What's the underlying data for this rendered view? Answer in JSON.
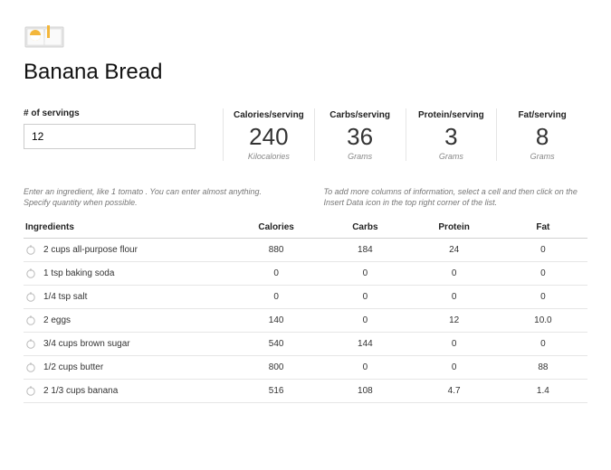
{
  "header": {
    "title": "Banana Bread",
    "icon": "recipe-book-icon"
  },
  "servings": {
    "label": "# of servings",
    "value": "12"
  },
  "stats": [
    {
      "title": "Calories/serving",
      "value": "240",
      "unit": "Kilocalories"
    },
    {
      "title": "Carbs/serving",
      "value": "36",
      "unit": "Grams"
    },
    {
      "title": "Protein/serving",
      "value": "3",
      "unit": "Grams"
    },
    {
      "title": "Fat/serving",
      "value": "8",
      "unit": "Grams"
    }
  ],
  "hints": {
    "left": "Enter an ingredient, like 1 tomato . You can enter almost anything. Specify quantity when possible.",
    "right": "To add more columns of information, select a cell and then click on the Insert Data icon in the top right corner of the list."
  },
  "table": {
    "headers": [
      "Ingredients",
      "Calories",
      "Carbs",
      "Protein",
      "Fat"
    ],
    "rows": [
      {
        "name": "2 cups all-purpose flour",
        "calories": "880",
        "carbs": "184",
        "protein": "24",
        "fat": "0"
      },
      {
        "name": "1 tsp baking soda",
        "calories": "0",
        "carbs": "0",
        "protein": "0",
        "fat": "0"
      },
      {
        "name": "1/4 tsp salt",
        "calories": "0",
        "carbs": "0",
        "protein": "0",
        "fat": "0"
      },
      {
        "name": "2 eggs",
        "calories": "140",
        "carbs": "0",
        "protein": "12",
        "fat": "10.0"
      },
      {
        "name": "3/4 cups brown sugar",
        "calories": "540",
        "carbs": "144",
        "protein": "0",
        "fat": "0"
      },
      {
        "name": "1/2 cups butter",
        "calories": "800",
        "carbs": "0",
        "protein": "0",
        "fat": "88"
      },
      {
        "name": "2 1/3 cups banana",
        "calories": "516",
        "carbs": "108",
        "protein": "4.7",
        "fat": "1.4"
      }
    ]
  }
}
